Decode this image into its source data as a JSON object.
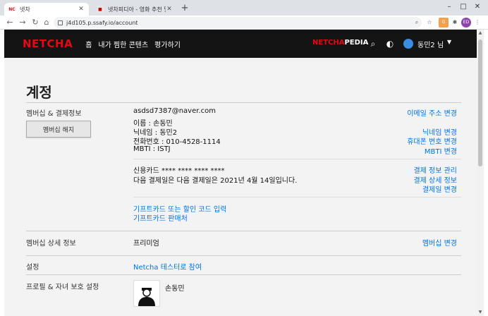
{
  "browser": {
    "tabs": [
      {
        "favicon": "NC",
        "title": "넷차"
      },
      {
        "favicon": "",
        "title": "넷차피디아 - 영화 추천 및 평가"
      }
    ],
    "url": "j4d105.p.ssafy.io/account",
    "extensions": {
      "ext1": "G",
      "avatar": "ED"
    }
  },
  "header": {
    "logo": "NETCHA",
    "nav": [
      "홈",
      "내가 찜한 콘텐츠",
      "평가하기"
    ],
    "pedia_main": "NETCHA",
    "pedia_sub": "PEDIA",
    "user": "동민2 님"
  },
  "account": {
    "title": "계정",
    "membership_label": "멤버십 & 결제정보",
    "cancel_button": "멤버십 해지",
    "email": "asdsd7387@naver.com",
    "name": "이름 : 손동민",
    "nickname": "닉네임 : 동민2",
    "phone": "전화번호 : 010-4528-1114",
    "mbti": "MBTI : ISTJ",
    "links": {
      "change_email": "이메일 주소 변경",
      "change_nickname": "닉네임 변경",
      "change_phone": "휴대폰 번호 변경",
      "change_mbti": "MBTI 변경"
    },
    "card": "신용카드 **** **** **** ****",
    "next_payment": "다음 결제일은 다음 결제일은 2021년 4월 14일입니다.",
    "payment_links": {
      "manage": "결제 정보 관리",
      "detail": "결제 상세 정보",
      "change_date": "결제일 변경"
    },
    "gift_code": "기프트카드 또는 할인 코드 입력",
    "gift_store": "기프트카드 판매처",
    "detail_label": "멤버십 상세 정보",
    "plan": "프리미엄",
    "change_plan": "멤버십 변경",
    "settings_label": "설정",
    "test_join": "Netcha 테스터로 참여",
    "profile_label": "프로필 & 자녀 보호 설정",
    "profile_name": "손동민"
  },
  "colors": {
    "brand": "#e50914",
    "link": "#0073e6",
    "header_bg": "#141414",
    "page_bg": "#f3f3f3"
  }
}
